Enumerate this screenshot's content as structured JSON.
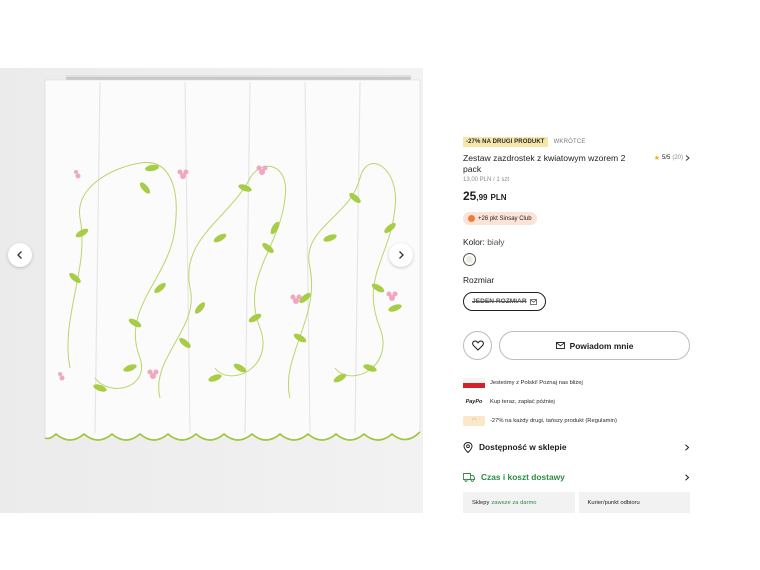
{
  "gallery": {
    "prev_label": "Poprzednie zdjęcie",
    "next_label": "Następne zdjęcie"
  },
  "product": {
    "promo_badge": "-27% NA DRUGI PRODUKT",
    "status_badge": "WKRÓTCE",
    "title": "Zestaw zazdrostek z kwiatowym wzorem 2 pack",
    "rating": "5/5",
    "rating_count": "(20)",
    "unit_price": "13,00 PLN / 1 szt",
    "price_int": "25",
    "price_dec": ",99",
    "price_currency": "PLN",
    "club_points": "+26 pkt Sinsay Club",
    "color_label": "Kolor:",
    "color_value": "biały",
    "size_label": "Rozmiar",
    "size_option": "JEDEN ROZMIAR"
  },
  "actions": {
    "notify_label": "Powiadom mnie"
  },
  "info": {
    "poland": "Jesteśmy z Polski! Poznaj nas bliżej",
    "paypo_logo": "PayPo",
    "paypo": "Kup teraz, zapłać później",
    "discount": "-27% na każdy drugi, tańszy produkt (Regulamin)"
  },
  "links": {
    "stores": "Dostępność w sklepie",
    "delivery": "Czas i koszt dostawy"
  },
  "shipping": {
    "stores_label": "Sklepy",
    "stores_value": "zawsze za darmo",
    "courier_label": "Kurier/punkt odbioru"
  },
  "colors": {
    "accent_green": "#2e8b46",
    "promo_yellow": "#f6e7a9",
    "club_peach": "#fde3d6",
    "flag_red": "#d2232a"
  }
}
